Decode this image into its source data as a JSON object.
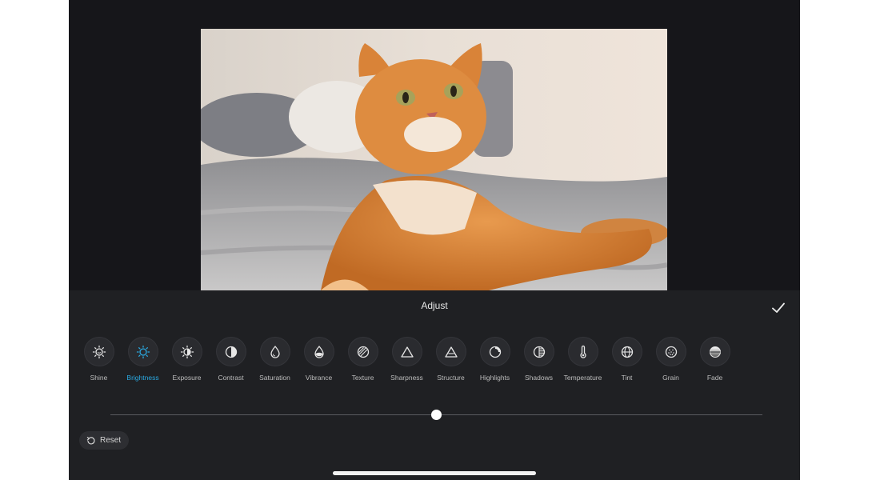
{
  "panel": {
    "title": "Adjust",
    "done_icon": "checkmark-icon"
  },
  "tools": [
    {
      "label": "Shine",
      "icon": "shine-icon",
      "active": false
    },
    {
      "label": "Brightness",
      "icon": "brightness-icon",
      "active": true
    },
    {
      "label": "Exposure",
      "icon": "exposure-icon",
      "active": false
    },
    {
      "label": "Contrast",
      "icon": "contrast-icon",
      "active": false
    },
    {
      "label": "Saturation",
      "icon": "saturation-icon",
      "active": false
    },
    {
      "label": "Vibrance",
      "icon": "vibrance-icon",
      "active": false
    },
    {
      "label": "Texture",
      "icon": "texture-icon",
      "active": false
    },
    {
      "label": "Sharpness",
      "icon": "sharpness-icon",
      "active": false
    },
    {
      "label": "Structure",
      "icon": "structure-icon",
      "active": false
    },
    {
      "label": "Highlights",
      "icon": "highlights-icon",
      "active": false
    },
    {
      "label": "Shadows",
      "icon": "shadows-icon",
      "active": false
    },
    {
      "label": "Temperature",
      "icon": "temperature-icon",
      "active": false
    },
    {
      "label": "Tint",
      "icon": "tint-icon",
      "active": false
    },
    {
      "label": "Grain",
      "icon": "grain-icon",
      "active": false
    },
    {
      "label": "Fade",
      "icon": "fade-icon",
      "active": false
    }
  ],
  "slider": {
    "value": 0.5
  },
  "reset": {
    "label": "Reset",
    "icon": "reset-icon"
  },
  "colors": {
    "accent": "#2aa8e0",
    "panel": "#1f2023",
    "background": "#16161a"
  }
}
